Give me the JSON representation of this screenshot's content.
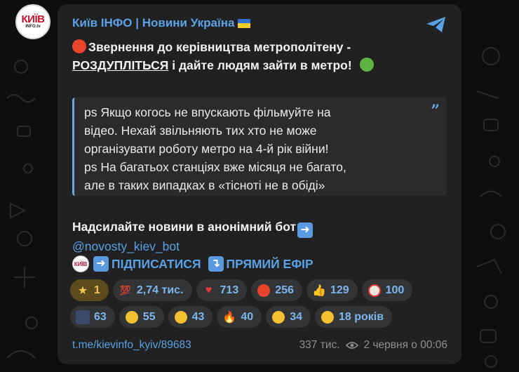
{
  "channel": {
    "name": "Київ ІНФО | Новини Україна",
    "avatar_text": "КИЇВ",
    "avatar_sub": "INFO.tv"
  },
  "message": {
    "line1": "Звернення до керівництва метрополітену -",
    "line2_underlined": "РОЗДУПЛІТЬСЯ",
    "line2_rest": " і дайте людям зайти в метро!",
    "quote_lines": [
      "ps Якщо когось не впускають фільмуйте на",
      "відео. Нехай звільняють тих хто не може",
      "організувати роботу метро на 4-й рік війни!",
      "ps На багатьох станціях вже місяця не багато,",
      "але в таких випадках в «тісноті не в обіді»"
    ],
    "quote_mark": "”",
    "cta": "Надсилайте новини в анонімний бот",
    "bot_handle": "@novosty_kiev_bot",
    "subscribe_label": "ПІДПИСАТИСЯ",
    "live_label": "ПРЯМИЙ ЕФІР"
  },
  "reactions": {
    "row1": [
      {
        "icon": "star-icon",
        "count": "1"
      },
      {
        "icon": "hundred-icon",
        "count": "2,74 тис."
      },
      {
        "icon": "heart-icon",
        "count": "713"
      },
      {
        "icon": "angry-face-icon",
        "count": "256"
      },
      {
        "icon": "thumbs-up-icon",
        "count": "129"
      },
      {
        "icon": "clown-icon",
        "count": "100"
      }
    ],
    "row2": [
      {
        "icon": "person-photo-icon",
        "count": "63"
      },
      {
        "icon": "screaming-face-icon",
        "count": "55"
      },
      {
        "icon": "laughing-face-icon",
        "count": "43"
      },
      {
        "icon": "fire-icon",
        "count": "40"
      },
      {
        "icon": "mind-blown-icon",
        "count": "34"
      },
      {
        "icon": "grin-face-icon",
        "count": "18 років"
      }
    ]
  },
  "footer": {
    "link": "t.me/kievinfo_kyiv/89683",
    "views": "337 тис.",
    "date": "2 червня о 00:06"
  },
  "colors": {
    "link": "#5aa2e6",
    "bubble": "#212121",
    "reaction_bg": "#333435",
    "highlight_bg": "#5b4b1d"
  }
}
